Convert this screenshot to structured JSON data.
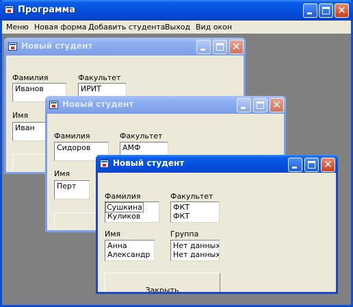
{
  "main_window": {
    "title": "Программа"
  },
  "menu": [
    {
      "label": "Меню"
    },
    {
      "label": "Новая форма"
    },
    {
      "label": "Добавить студента"
    },
    {
      "label": "Выход"
    },
    {
      "label": "Вид окон"
    }
  ],
  "children": [
    {
      "title": "Новый студент",
      "labels": {
        "surname": "Фамилия",
        "faculty": "Факультет",
        "name": "Имя"
      },
      "surname": [
        "Иванов"
      ],
      "faculty": [
        "ИРИТ"
      ],
      "name": [
        "Иван"
      ]
    },
    {
      "title": "Новый студент",
      "labels": {
        "surname": "Фамилия",
        "faculty": "Факультет",
        "name": "Имя"
      },
      "surname": [
        "Сидоров"
      ],
      "faculty": [
        "АМФ"
      ],
      "name": [
        "Перт"
      ]
    },
    {
      "title": "Новый студент",
      "labels": {
        "surname": "Фамилия",
        "faculty": "Факультет",
        "name": "Имя",
        "group": "Группа"
      },
      "surname": [
        "Сушкина",
        "Куликов"
      ],
      "faculty": [
        "ФКТ",
        "ФКТ"
      ],
      "name": [
        "Анна",
        "Александр"
      ],
      "group": [
        "Нет данных",
        "Нет данных"
      ],
      "close_button": "Закрыть"
    }
  ],
  "icons": [
    "app-window-icon",
    "minimize-icon",
    "maximize-icon",
    "close-icon"
  ]
}
